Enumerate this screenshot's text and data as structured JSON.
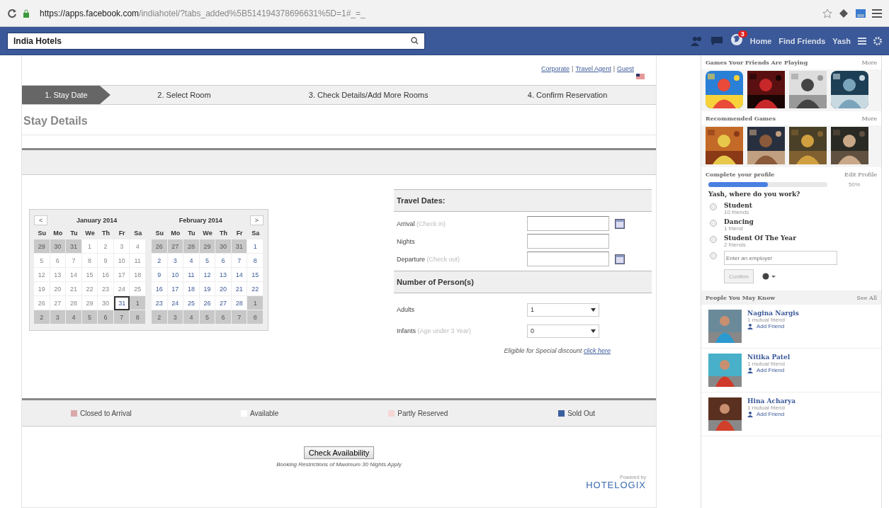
{
  "browser": {
    "url_host": "https://apps.facebook.com",
    "url_path": "/indiahotel/?tabs_added%5B514194378696631%5D=1#_=_"
  },
  "fb_bar": {
    "search_value": "India Hotels",
    "notification_count": "3",
    "nav": [
      "Home",
      "Find Friends",
      "Yash"
    ]
  },
  "top_links": [
    "Corporate",
    "Travel Agent",
    "Guest"
  ],
  "top_links_separator": "|",
  "steps": [
    {
      "label": "1. Stay Date",
      "selected": true
    },
    {
      "label": "2. Select Room",
      "selected": false
    },
    {
      "label": "3. Check Details/Add More Rooms",
      "selected": false
    },
    {
      "label": "4. Confirm Reservation",
      "selected": false
    }
  ],
  "page_title": "Stay Details",
  "calendars": [
    {
      "month": "January 2014",
      "nav": "<",
      "weekdays": [
        "Su",
        "Mo",
        "Tu",
        "We",
        "Th",
        "Fr",
        "Sa"
      ],
      "weeks": [
        [
          {
            "day": "29",
            "kind": "other"
          },
          {
            "day": "30",
            "kind": "other"
          },
          {
            "day": "31",
            "kind": "other"
          },
          {
            "day": "1",
            "kind": "past"
          },
          {
            "day": "2",
            "kind": "past"
          },
          {
            "day": "3",
            "kind": "past"
          },
          {
            "day": "4",
            "kind": "past"
          }
        ],
        [
          {
            "day": "5",
            "kind": "past"
          },
          {
            "day": "6",
            "kind": "past"
          },
          {
            "day": "7",
            "kind": "past"
          },
          {
            "day": "8",
            "kind": "past"
          },
          {
            "day": "9",
            "kind": "past"
          },
          {
            "day": "10",
            "kind": "past"
          },
          {
            "day": "11",
            "kind": "past"
          }
        ],
        [
          {
            "day": "12",
            "kind": "past"
          },
          {
            "day": "13",
            "kind": "past"
          },
          {
            "day": "14",
            "kind": "past"
          },
          {
            "day": "15",
            "kind": "past"
          },
          {
            "day": "16",
            "kind": "past"
          },
          {
            "day": "17",
            "kind": "past"
          },
          {
            "day": "18",
            "kind": "past"
          }
        ],
        [
          {
            "day": "19",
            "kind": "past"
          },
          {
            "day": "20",
            "kind": "past"
          },
          {
            "day": "21",
            "kind": "past"
          },
          {
            "day": "22",
            "kind": "past"
          },
          {
            "day": "23",
            "kind": "past"
          },
          {
            "day": "24",
            "kind": "past"
          },
          {
            "day": "25",
            "kind": "past"
          }
        ],
        [
          {
            "day": "26",
            "kind": "past"
          },
          {
            "day": "27",
            "kind": "past"
          },
          {
            "day": "28",
            "kind": "past"
          },
          {
            "day": "29",
            "kind": "past"
          },
          {
            "day": "30",
            "kind": "past"
          },
          {
            "day": "31",
            "kind": "today"
          },
          {
            "day": "1",
            "kind": "other"
          }
        ],
        [
          {
            "day": "2",
            "kind": "other"
          },
          {
            "day": "3",
            "kind": "other"
          },
          {
            "day": "4",
            "kind": "other"
          },
          {
            "day": "5",
            "kind": "other"
          },
          {
            "day": "6",
            "kind": "other"
          },
          {
            "day": "7",
            "kind": "other"
          },
          {
            "day": "8",
            "kind": "other"
          }
        ]
      ]
    },
    {
      "month": "February 2014",
      "nav": ">",
      "weekdays": [
        "Su",
        "Mo",
        "Tu",
        "We",
        "Th",
        "Fr",
        "Sa"
      ],
      "weeks": [
        [
          {
            "day": "26",
            "kind": "other"
          },
          {
            "day": "27",
            "kind": "other"
          },
          {
            "day": "28",
            "kind": "other"
          },
          {
            "day": "29",
            "kind": "other"
          },
          {
            "day": "30",
            "kind": "other"
          },
          {
            "day": "31",
            "kind": "other"
          },
          {
            "day": "1",
            "kind": "available"
          }
        ],
        [
          {
            "day": "2",
            "kind": "available"
          },
          {
            "day": "3",
            "kind": "available"
          },
          {
            "day": "4",
            "kind": "available"
          },
          {
            "day": "5",
            "kind": "available"
          },
          {
            "day": "6",
            "kind": "available"
          },
          {
            "day": "7",
            "kind": "available"
          },
          {
            "day": "8",
            "kind": "available"
          }
        ],
        [
          {
            "day": "9",
            "kind": "available"
          },
          {
            "day": "10",
            "kind": "available"
          },
          {
            "day": "11",
            "kind": "available"
          },
          {
            "day": "12",
            "kind": "available"
          },
          {
            "day": "13",
            "kind": "available"
          },
          {
            "day": "14",
            "kind": "available"
          },
          {
            "day": "15",
            "kind": "available"
          }
        ],
        [
          {
            "day": "16",
            "kind": "available"
          },
          {
            "day": "17",
            "kind": "available"
          },
          {
            "day": "18",
            "kind": "available"
          },
          {
            "day": "19",
            "kind": "available"
          },
          {
            "day": "20",
            "kind": "available"
          },
          {
            "day": "21",
            "kind": "available"
          },
          {
            "day": "22",
            "kind": "available"
          }
        ],
        [
          {
            "day": "23",
            "kind": "available"
          },
          {
            "day": "24",
            "kind": "available"
          },
          {
            "day": "25",
            "kind": "available"
          },
          {
            "day": "26",
            "kind": "available"
          },
          {
            "day": "27",
            "kind": "available"
          },
          {
            "day": "28",
            "kind": "available"
          },
          {
            "day": "1",
            "kind": "other"
          }
        ],
        [
          {
            "day": "2",
            "kind": "other"
          },
          {
            "day": "3",
            "kind": "other"
          },
          {
            "day": "4",
            "kind": "other"
          },
          {
            "day": "5",
            "kind": "other"
          },
          {
            "day": "6",
            "kind": "other"
          },
          {
            "day": "7",
            "kind": "other"
          },
          {
            "day": "8",
            "kind": "other"
          }
        ]
      ]
    }
  ],
  "travel_dates": {
    "heading": "Travel Dates:",
    "fields": [
      {
        "label": "Arrival",
        "hint": "(Check in)",
        "calendar_button": true
      },
      {
        "label": "Nights",
        "calendar_button": false
      },
      {
        "label": "Departure",
        "hint": "(Check out)",
        "calendar_button": true
      }
    ]
  },
  "persons": {
    "heading": "Number of Person(s)",
    "selects": [
      {
        "label": "Adults",
        "value": "1"
      },
      {
        "label": "Infants",
        "hint": "(Age under 3 Year)",
        "value": "0"
      }
    ],
    "discount_text": "Eligible for Special discount",
    "discount_link": "click here"
  },
  "legend": [
    {
      "label": "Closed to Arrival",
      "color": "#d9a9a9"
    },
    {
      "label": "Available",
      "color": "#ffffff"
    },
    {
      "label": "Partly Reserved",
      "color": "#f7d6d6"
    },
    {
      "label": "Sold Out",
      "color": "#3a5f9e"
    }
  ],
  "check_button": "Check Availability",
  "restriction_note": "Booking Restrictions of Maximum 30 Nights Apply",
  "powered_by": "Powered by",
  "brand": "HOTELOGIX",
  "sidebar": {
    "games_friends": {
      "title": "Games Your Friends Are Playing",
      "more": "More"
    },
    "games_recommended": {
      "title": "Recommended Games",
      "more": "More"
    },
    "profile": {
      "title": "Complete your profile",
      "edit": "Edit Profile",
      "level": 0.5,
      "percent": "50%",
      "question": "Yash, where do you work?",
      "options": [
        {
          "name": "Student",
          "sub": "10 friends",
          "selected": false
        },
        {
          "name": "Dancing",
          "sub": "1 friend",
          "selected": false
        },
        {
          "name": "Student Of The Year",
          "sub": "2 friends",
          "selected": false
        }
      ],
      "employer_selected": false,
      "employer_placeholder": "Enter an employer",
      "confirm": "Confirm"
    },
    "people": {
      "title": "People You May Know",
      "see_all": "See All",
      "items": [
        {
          "name": "Nagina Nargis",
          "mutual": "1 mutual friend",
          "action": "Add Friend"
        },
        {
          "name": "Nitika Patel",
          "mutual": "1 mutual friend",
          "action": "Add Friend"
        },
        {
          "name": "Hina Acharya",
          "mutual": "1 mutual friend",
          "action": "Add Friend"
        }
      ]
    }
  }
}
